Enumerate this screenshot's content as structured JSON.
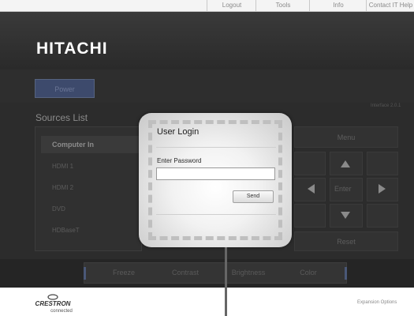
{
  "nav": {
    "links": [
      "Logout",
      "Tools",
      "Info",
      "Contact IT Help"
    ]
  },
  "brand": {
    "logo": "HITACHI"
  },
  "power": {
    "label": "Power"
  },
  "sources": {
    "title": "Sources List",
    "items": [
      "Computer In",
      "HDMI 1",
      "HDMI 2",
      "DVD",
      "HDBaseT"
    ],
    "selected": "Computer In"
  },
  "version": "Interface 2.0.1",
  "controls": {
    "menu": "Menu",
    "enter": "Enter",
    "reset": "Reset"
  },
  "toolbar": {
    "items": [
      "Freeze",
      "Contrast",
      "Brightness",
      "Color"
    ]
  },
  "footer": {
    "crestron": "CRESTRON",
    "crestron_sub": "connected",
    "expansion": "Expansion Options"
  },
  "login": {
    "title": "User Login",
    "password_label": "Enter Password",
    "password_value": "",
    "send_label": "Send"
  },
  "colors": {
    "header_bg": "#2e2e2e",
    "power_button": "#3d4a6c",
    "dialog_bg": "#e8e8e8"
  }
}
